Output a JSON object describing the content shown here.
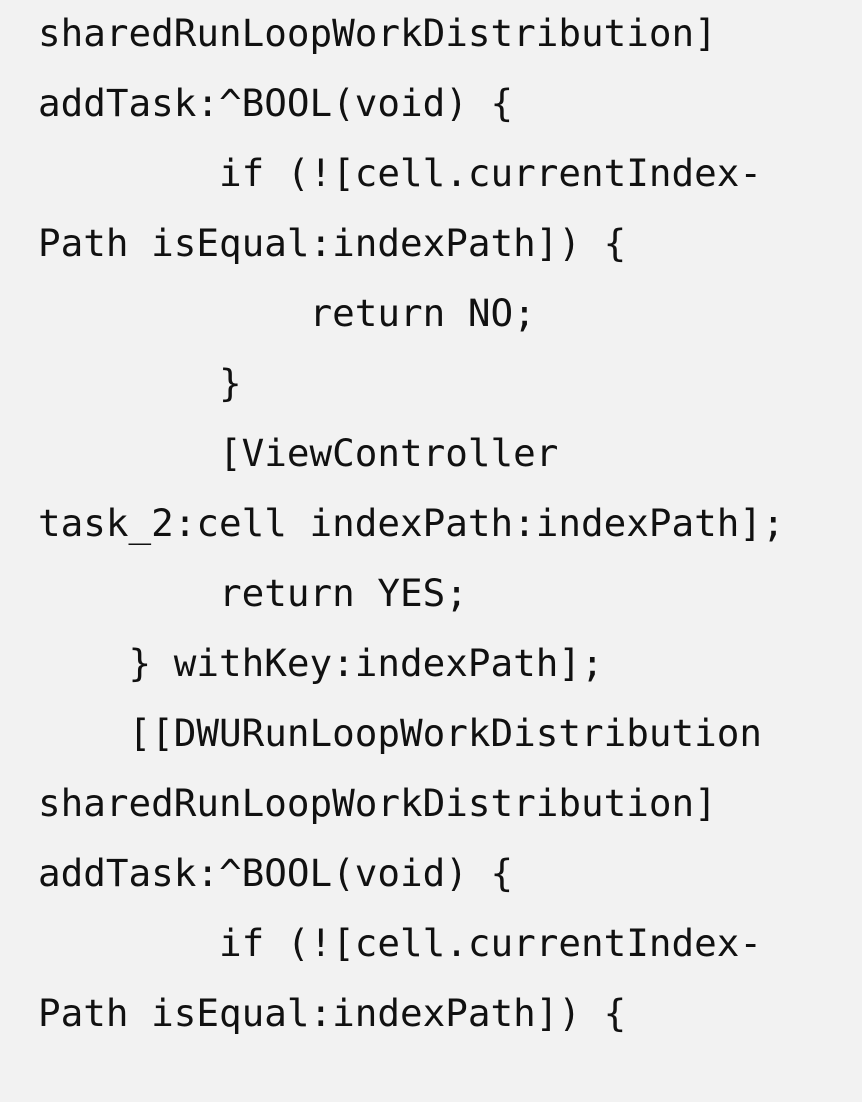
{
  "code": {
    "lines": [
      "sharedRunLoopWorkDistribution]",
      "addTask:^BOOL(void) {",
      "        if (![cell.currentIndex-",
      "Path isEqual:indexPath]) {",
      "            return NO;",
      "        }",
      "        [ViewController",
      "task_2:cell indexPath:indexPath];",
      "        return YES;",
      "    } withKey:indexPath];",
      "    [[DWURunLoopWorkDistribution",
      "sharedRunLoopWorkDistribution]",
      "addTask:^BOOL(void) {",
      "        if (![cell.currentIndex-",
      "Path isEqual:indexPath]) {"
    ]
  }
}
